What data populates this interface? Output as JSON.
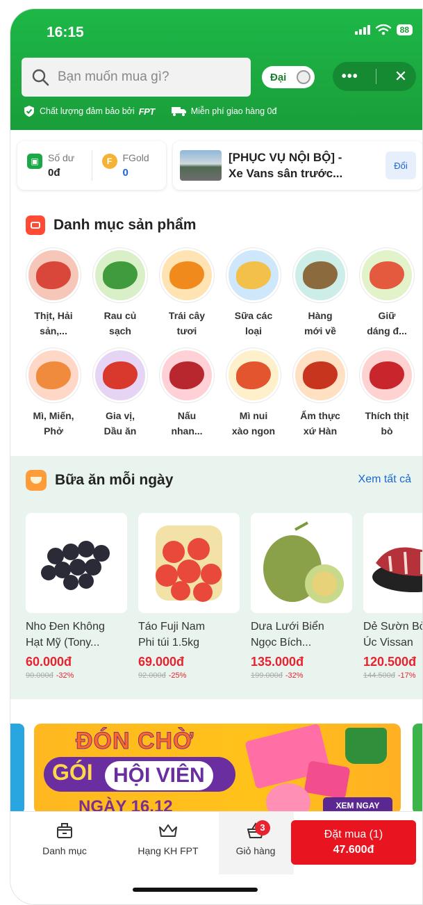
{
  "status": {
    "time": "16:15",
    "battery": "88"
  },
  "header": {
    "search_placeholder": "Bạn muốn mua gì?",
    "size_label": "Đại",
    "quality_text": "Chất lượng đảm bảo bởi",
    "fpt_logo": "FPT",
    "shipping_text": "Miễn phí giao hàng 0đ"
  },
  "wallet": {
    "balance_label": "Số dư",
    "balance_value": "0đ",
    "fgold_label": "FGold",
    "fgold_value": "0"
  },
  "address": {
    "line1": "[PHỤC VỤ NỘI BỘ] -",
    "line2": "Xe Vans sân trước...",
    "change_label": "Đổi"
  },
  "categories": {
    "title": "Danh mục sản phẩm",
    "items": [
      {
        "l1": "Thịt, Hải",
        "l2": "sản,...",
        "bg": "#f6c7b8",
        "fg": "#d9473a"
      },
      {
        "l1": "Rau củ",
        "l2": "sạch",
        "bg": "#d8efc8",
        "fg": "#3f9b3b"
      },
      {
        "l1": "Trái cây",
        "l2": "tươi",
        "bg": "#ffe3b3",
        "fg": "#f08a1d"
      },
      {
        "l1": "Sữa các",
        "l2": "loại",
        "bg": "#cfe7fb",
        "fg": "#f3c04a"
      },
      {
        "l1": "Hàng",
        "l2": "mới về",
        "bg": "#cdeee8",
        "fg": "#8b6b3d"
      },
      {
        "l1": "Giữ",
        "l2": "dáng đ...",
        "bg": "#e2f3c9",
        "fg": "#e35a3e"
      },
      {
        "l1": "Mì, Miến,",
        "l2": "Phở",
        "bg": "#ffd7c7",
        "fg": "#f08a3c"
      },
      {
        "l1": "Gia vị,",
        "l2": "Dầu ăn",
        "bg": "#e6d4f5",
        "fg": "#d8392c"
      },
      {
        "l1": "Nấu",
        "l2": "nhan...",
        "bg": "#ffd0d5",
        "fg": "#b8262e"
      },
      {
        "l1": "Mì nui",
        "l2": "xào ngon",
        "bg": "#fff0cc",
        "fg": "#e2552f"
      },
      {
        "l1": "Ẩm thực",
        "l2": "xứ Hàn",
        "bg": "#ffe0c2",
        "fg": "#c8351f"
      },
      {
        "l1": "Thích thịt",
        "l2": "bò",
        "bg": "#ffd2d2",
        "fg": "#c9252c"
      }
    ]
  },
  "meals": {
    "title": "Bữa ăn mỗi ngày",
    "see_all": "Xem tất cả",
    "products": [
      {
        "l1": "Nho Đen Không",
        "l2": "Hạt Mỹ (Tony...",
        "price": "60.000đ",
        "old": "90.000đ",
        "disc": "-32%",
        "c": "#2b2b38"
      },
      {
        "l1": "Táo Fuji Nam",
        "l2": "Phi túi 1.5kg",
        "price": "69.000đ",
        "old": "92.000đ",
        "disc": "-25%",
        "c": "#e8493a"
      },
      {
        "l1": "Dưa Lưới Biển",
        "l2": "Ngọc Bích...",
        "price": "135.000đ",
        "old": "199.000đ",
        "disc": "-32%",
        "c": "#8aa14a"
      },
      {
        "l1": "Dẻ Sườn Bò",
        "l2": "Úc Vissan",
        "price": "120.500đ",
        "old": "144.500đ",
        "disc": "-17%",
        "c": "#b5323a"
      }
    ]
  },
  "banner": {
    "line1": "ĐÓN CHỜ",
    "line2a": "GÓI",
    "line2b": "HỘI VIÊN",
    "line3": "NGÀY 16.12",
    "cta": "XEM NGAY"
  },
  "bottom_nav": {
    "categories": "Danh mục",
    "rank": "Hạng KH FPT",
    "cart": "Giỏ hàng",
    "cart_count": "3",
    "order_label": "Đặt mua (1)",
    "order_total": "47.600đ"
  }
}
